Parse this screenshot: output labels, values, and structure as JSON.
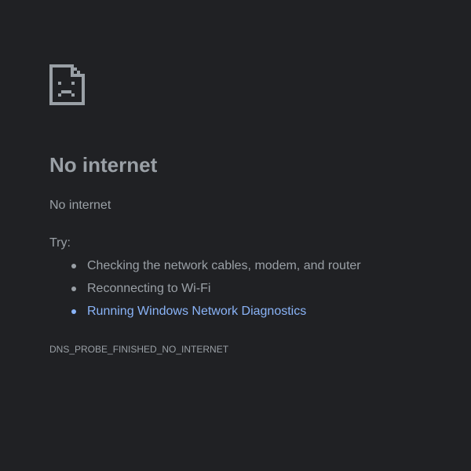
{
  "page": {
    "icon": "sad-page-icon",
    "title": "No internet",
    "subtitle": "No internet",
    "try_label": "Try:",
    "suggestions": [
      "Checking the network cables, modem, and router",
      "Reconnecting to Wi-Fi"
    ],
    "diagnostics_link": "Running Windows Network Diagnostics",
    "error_code": "DNS_PROBE_FINISHED_NO_INTERNET"
  },
  "colors": {
    "background": "#202124",
    "text": "#9aa0a6",
    "link": "#8ab4f8"
  }
}
